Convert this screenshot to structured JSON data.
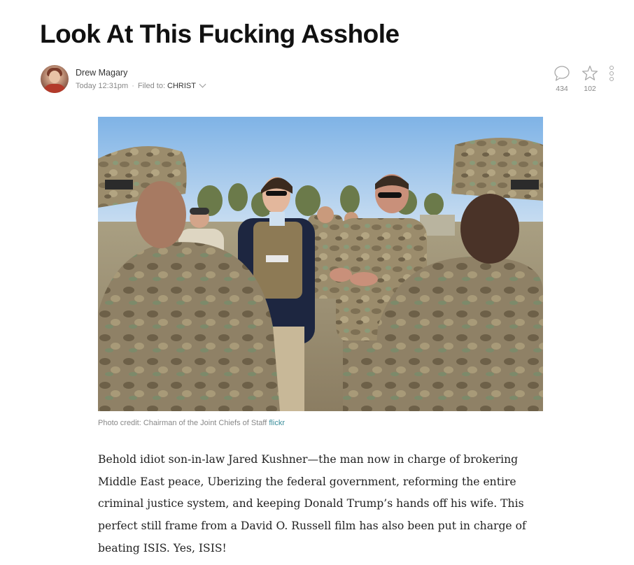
{
  "article": {
    "title": "Look At This Fucking Asshole",
    "author": "Drew Magary",
    "timestamp": "Today 12:31pm",
    "filed_label": "Filed to:",
    "category": "CHRIST",
    "comments_count": "434",
    "stars_count": "102",
    "caption_text": "Photo credit: Chairman of the Joint Chiefs of Staff ",
    "caption_link": "flickr",
    "body": "Behold idiot son-in-law Jared Kushner—the man now in charge of brokering Middle East peace, Uberizing the federal government, reforming the entire criminal justice system, and keeping Donald Trump’s hands off his wife. This perfect still frame from a David O. Russell film has also been put in charge of beating ISIS. Yes, ISIS!"
  },
  "icons": {
    "comments": "speech-bubble-icon",
    "star": "star-icon",
    "more": "vertical-dots-icon",
    "filed_dropdown": "chevron-down-icon"
  },
  "colors": {
    "link": "#3a8d9a",
    "meta_text": "#888888",
    "headline": "#111111"
  }
}
